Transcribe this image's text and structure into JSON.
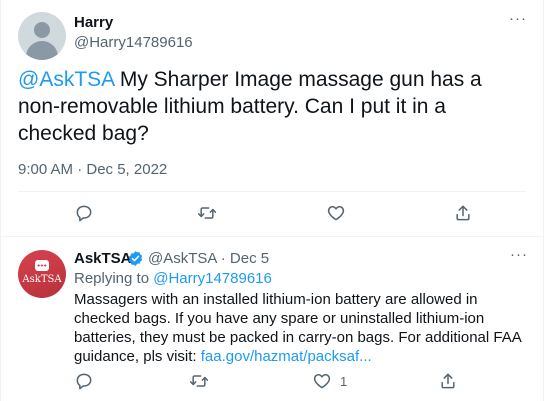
{
  "tweet": {
    "author_name": "Harry",
    "author_handle": "@Harry14789616",
    "more_label": "···",
    "text_mention": "@AskTSA",
    "text_body": " My Sharper Image massage gun has a non-removable lithium battery. Can I put it in a checked bag?",
    "timestamp": "9:00 AM · Dec 5, 2022",
    "actions": [
      "reply-icon",
      "retweet-icon",
      "like-icon",
      "share-icon"
    ]
  },
  "reply": {
    "author_name": "AskTSA",
    "avatar_text": "AskTSA",
    "verified": true,
    "meta": "@AskTSA · Dec 5",
    "more_label": "···",
    "replying_prefix": "Replying to ",
    "replying_handle": "@Harry14789616",
    "text_body": "Massagers with an installed lithium-ion battery are allowed in checked bags. If you have any spare or uninstalled lithium-ion batteries, they must be packed in carry-on bags. For additional FAA guidance, pls visit: ",
    "link_text": "faa.gov/hazmat/packsaf...",
    "like_count": "1"
  },
  "colors": {
    "accent": "#1d9bf0",
    "secondary_text": "#536471",
    "verified": "#1d9bf0",
    "tsa_red": "#d6434f"
  }
}
